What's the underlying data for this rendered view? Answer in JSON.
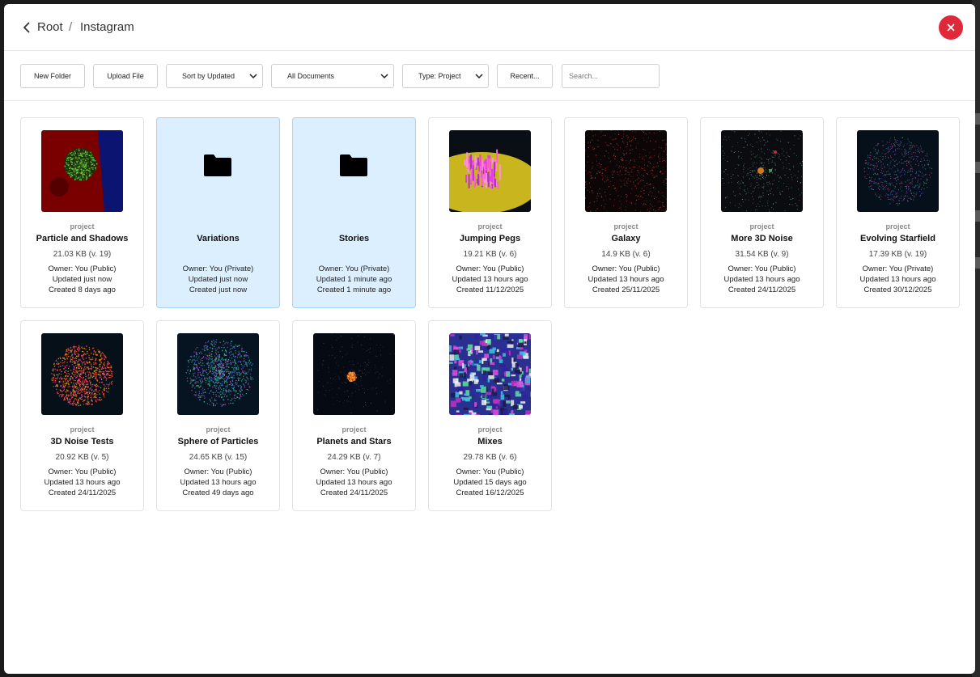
{
  "breadcrumb": {
    "root": "Root",
    "separator": "/",
    "current": "Instagram"
  },
  "close_symbol": "×",
  "toolbar": {
    "new_folder": "New Folder",
    "upload_file": "Upload File",
    "sort": "Sort by Updated",
    "filter_docs": "All Documents",
    "type_filter": "Type: Project",
    "recent": "Recent...",
    "search_placeholder": "Search..."
  },
  "colors": {
    "accent_close": "#e0283b",
    "folder_bg": "#dcefff",
    "folder_border": "#a9d1f0"
  },
  "items": [
    {
      "type": "project",
      "name": "Particle and Shadows",
      "size": "21.03 KB (v. 19)",
      "owner": "Owner: You (Public)",
      "updated": "Updated just now",
      "created": "Created 8 days ago",
      "thumb": "particle-shadows"
    },
    {
      "type": "",
      "name": "Variations",
      "size": "",
      "owner": "Owner: You (Private)",
      "updated": "Updated just now",
      "created": "Created just now",
      "thumb": "folder"
    },
    {
      "type": "",
      "name": "Stories",
      "size": "",
      "owner": "Owner: You (Private)",
      "updated": "Updated 1 minute ago",
      "created": "Created 1 minute ago",
      "thumb": "folder"
    },
    {
      "type": "project",
      "name": "Jumping Pegs",
      "size": "19.21 KB (v. 6)",
      "owner": "Owner: You (Public)",
      "updated": "Updated 13 hours ago",
      "created": "Created 11/12/2025",
      "thumb": "jumping-pegs"
    },
    {
      "type": "project",
      "name": "Galaxy",
      "size": "14.9 KB (v. 6)",
      "owner": "Owner: You (Public)",
      "updated": "Updated 13 hours ago",
      "created": "Created 25/11/2025",
      "thumb": "galaxy"
    },
    {
      "type": "project",
      "name": "More 3D Noise",
      "size": "31.54 KB (v. 9)",
      "owner": "Owner: You (Public)",
      "updated": "Updated 13 hours ago",
      "created": "Created 24/11/2025",
      "thumb": "more-3d-noise"
    },
    {
      "type": "project",
      "name": "Evolving Starfield",
      "size": "17.39 KB (v. 19)",
      "owner": "Owner: You (Private)",
      "updated": "Updated 13 hours ago",
      "created": "Created 30/12/2025",
      "thumb": "evolving-starfield"
    },
    {
      "type": "project",
      "name": "3D Noise Tests",
      "size": "20.92 KB (v. 5)",
      "owner": "Owner: You (Public)",
      "updated": "Updated 13 hours ago",
      "created": "Created 24/11/2025",
      "thumb": "noise-tests"
    },
    {
      "type": "project",
      "name": "Sphere of Particles",
      "size": "24.65 KB (v. 15)",
      "owner": "Owner: You (Public)",
      "updated": "Updated 13 hours ago",
      "created": "Created 49 days ago",
      "thumb": "sphere-particles"
    },
    {
      "type": "project",
      "name": "Planets and Stars",
      "size": "24.29 KB (v. 7)",
      "owner": "Owner: You (Public)",
      "updated": "Updated 13 hours ago",
      "created": "Created 24/11/2025",
      "thumb": "planets-stars"
    },
    {
      "type": "project",
      "name": "Mixes",
      "size": "29.78 KB (v. 6)",
      "owner": "Owner: You (Public)",
      "updated": "Updated 15 days ago",
      "created": "Created 16/12/2025",
      "thumb": "mixes"
    }
  ]
}
